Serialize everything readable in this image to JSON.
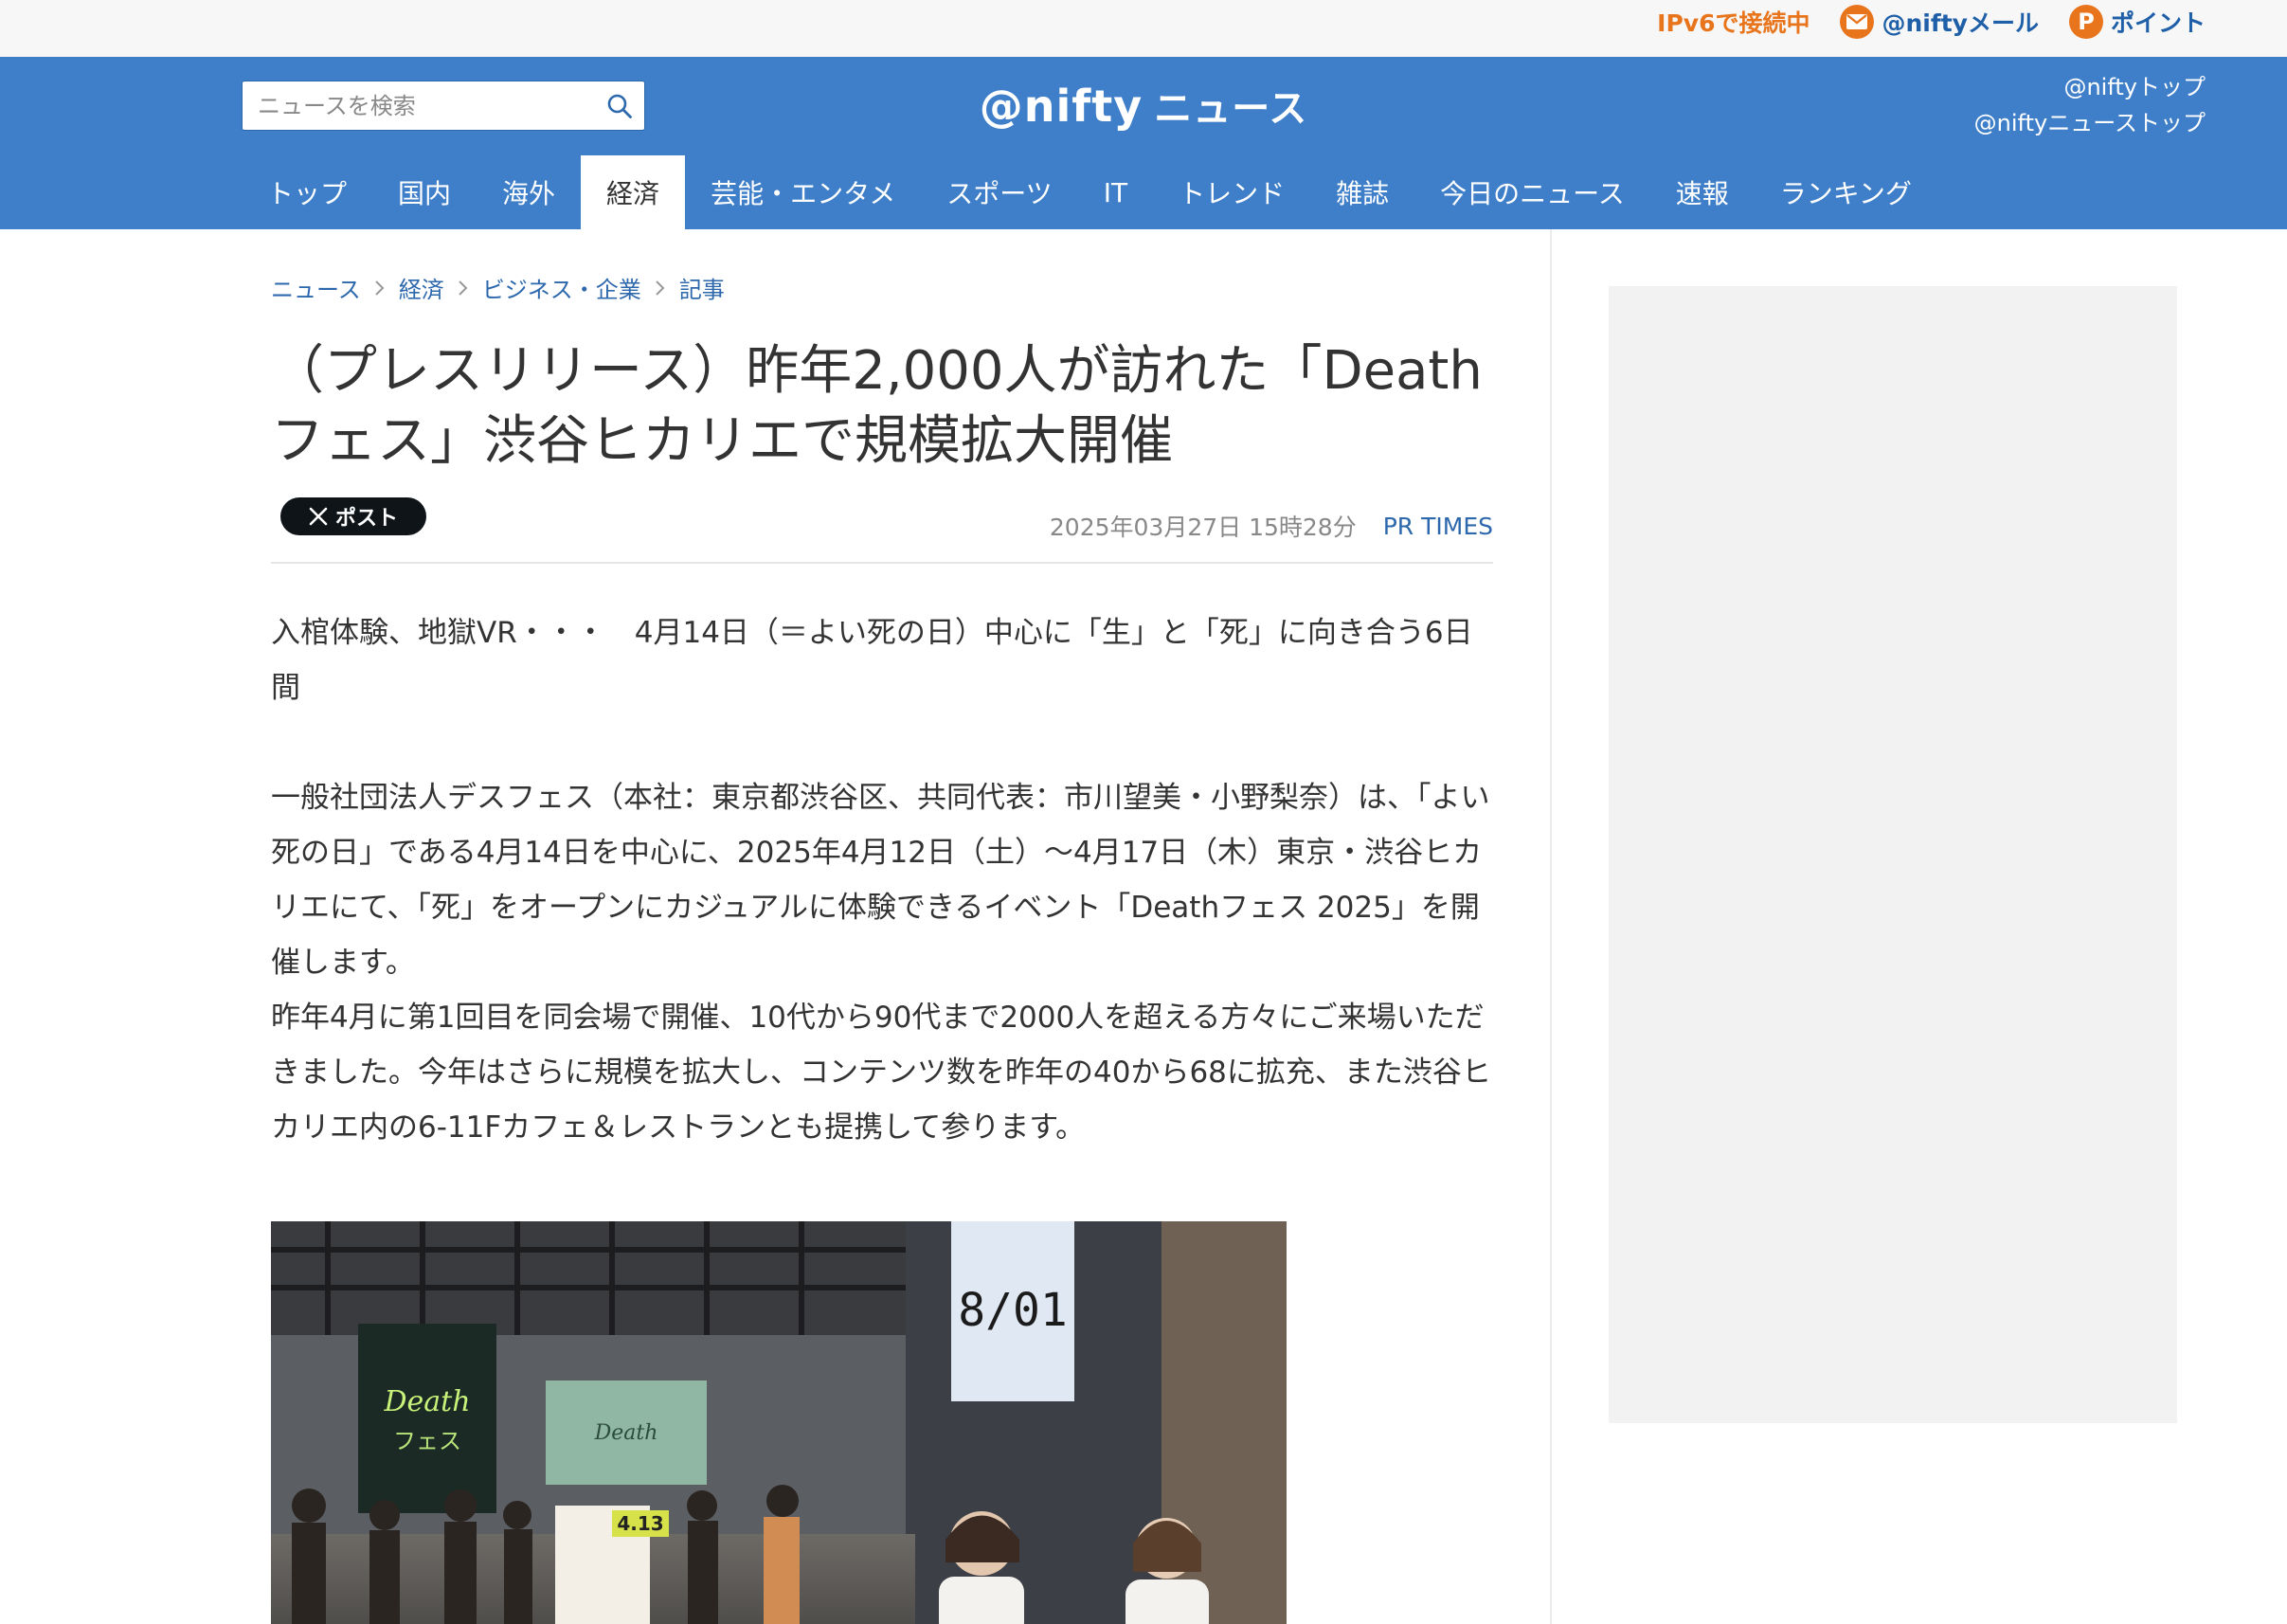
{
  "topbar": {
    "ipv6_label": "IPv6で接続中",
    "mail_label": "@niftyメール",
    "point_label": "ポイント",
    "point_letter": "P",
    "accent_color": "#e8741c",
    "link_color": "#1e5fa8"
  },
  "header": {
    "background_color": "#3f7fc9",
    "search": {
      "placeholder": "ニュースを検索",
      "value": ""
    },
    "logo_main": "@nifty",
    "logo_sub": "ニュース",
    "links": [
      "@niftyトップ",
      "@niftyニューストップ"
    ]
  },
  "nav": {
    "items": [
      "トップ",
      "国内",
      "海外",
      "経済",
      "芸能・エンタメ",
      "スポーツ",
      "IT",
      "トレンド",
      "雑誌",
      "今日のニュース",
      "速報",
      "ランキング"
    ],
    "active": "経済"
  },
  "breadcrumb": [
    "ニュース",
    "経済",
    "ビジネス・企業",
    "記事"
  ],
  "article": {
    "title_line1": "（プレスリリース）昨年2,000人が訪れた「Death",
    "title_line2": "フェス」渋谷ヒカリエで規模拡大開催",
    "post_button": "ポスト",
    "date": "2025年03月27日 15時28分",
    "source": "PR TIMES",
    "lead": "入棺体験、地獄VR・・・　4月14日（＝よい死の日）中心に「生」と「死」に向き合う6日間",
    "paragraph1": "一般社団法人デスフェス（本社：東京都渋谷区、共同代表：市川望美・小野梨奈）は、「よい死の日」である4月14日を中心に、2025年4月12日（土）～4月17日（木）東京・渋谷ヒカリエにて、「死」をオープンにカジュアルに体験できるイベント「Deathフェス 2025」を開催します。",
    "paragraph2": "昨年4月に第1回目を同会場で開催、10代から90代まで2000人を超える方々にご来場いただきました。今年はさらに規模を拡大し、コンテンツ数を昨年の40から68に拡充、また渋谷ヒカリエ内の6-11Fカフェ＆レストランとも提携して参ります。"
  },
  "photo": {
    "sign_text": "8/01",
    "banner_text": "Death\nフェス",
    "screen_text": "Death",
    "board_text": "4.13"
  },
  "icons": {
    "mail": "envelope-icon",
    "point": "point-icon",
    "search": "search-icon",
    "breadcrumb_separator": "chevron-right-icon",
    "x": "x-logo-icon"
  }
}
